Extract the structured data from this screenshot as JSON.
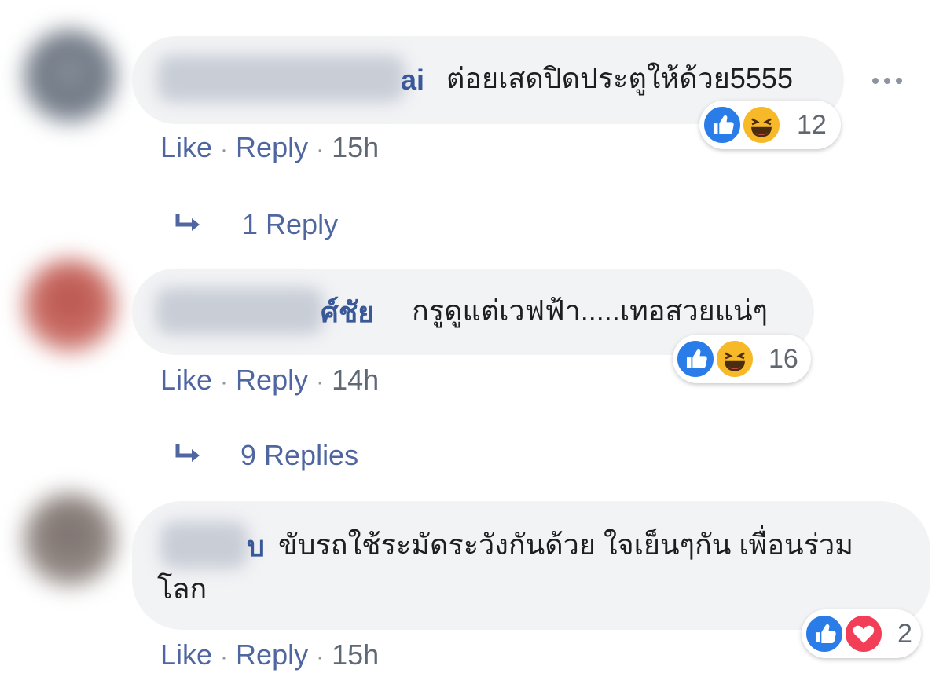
{
  "comments": [
    {
      "author_visible": "ai",
      "text_line1": "ต่อยเสดปิดประตูให้ด้วย5555",
      "text_line2": "",
      "reaction_icons": [
        "thumbs-up-icon",
        "laughing-face-icon"
      ],
      "reaction_count": "12",
      "like_label": "Like",
      "reply_label": "Reply",
      "separator": "·",
      "time": "15h",
      "replies_label": "1 Reply"
    },
    {
      "author_visible": "ศ์ชัย",
      "text_line1": "กรูดูแต่เวฟฟ้า.....เทอสวยแน่ๆ",
      "text_line2": "",
      "reaction_icons": [
        "thumbs-up-icon",
        "laughing-face-icon"
      ],
      "reaction_count": "16",
      "like_label": "Like",
      "reply_label": "Reply",
      "separator": "·",
      "time": "14h",
      "replies_label": "9 Replies"
    },
    {
      "author_visible": "บ",
      "text_line1": "ขับรถใช้ระมัดระวังกันด้วย ใจเย็นๆกัน เพื่อนร่วม",
      "text_line2": "โลก",
      "reaction_icons": [
        "thumbs-up-icon",
        "heart-icon"
      ],
      "reaction_count": "2",
      "like_label": "Like",
      "reply_label": "Reply",
      "separator": "·",
      "time": "15h",
      "replies_label": ""
    }
  ],
  "colors": {
    "bubble": "#f2f3f5",
    "link": "#385898",
    "like_blue": "#2a7ce8",
    "haha_yellow": "#f7b928",
    "love_red": "#f33e58"
  }
}
